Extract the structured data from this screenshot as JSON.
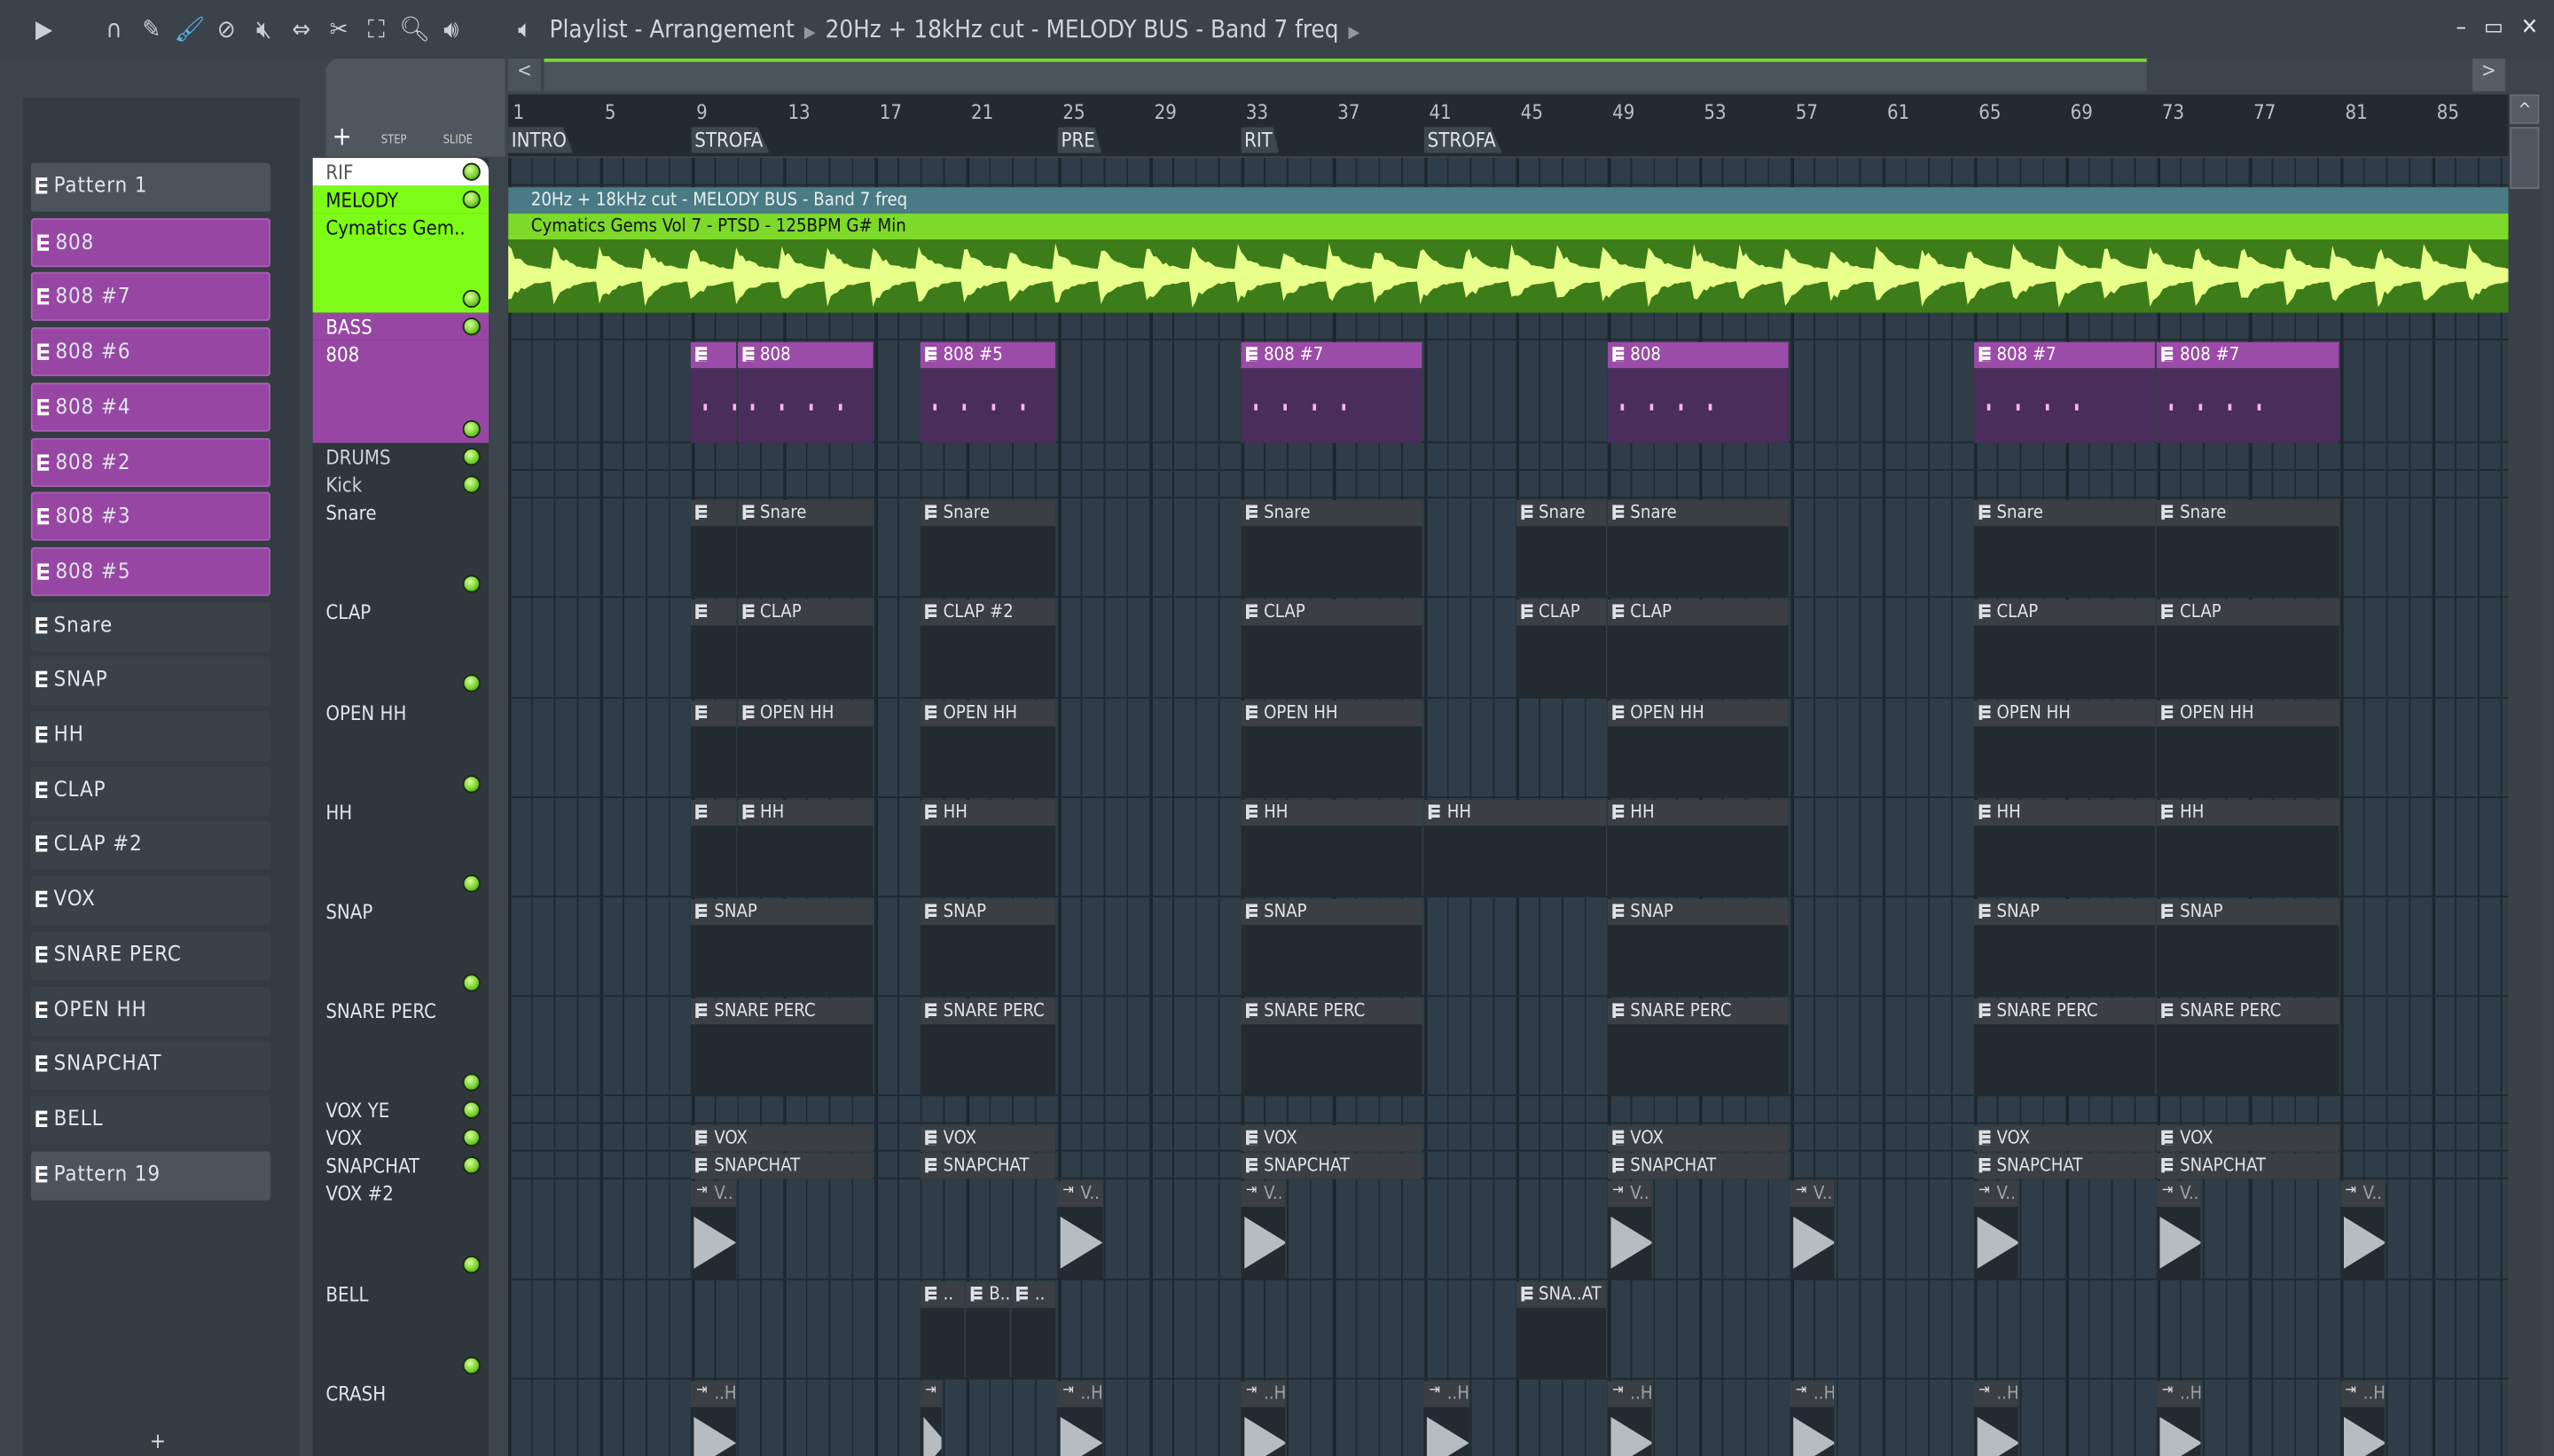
{
  "titlebar": {
    "breadcrumb": [
      "Playlist - Arrangement",
      "20Hz + 18kHz cut - MELODY BUS - Band 7 freq"
    ],
    "tools": [
      "play-arrow-icon",
      "magnet-icon",
      "pencil-icon",
      "paint-icon",
      "delete-icon",
      "mute-icon",
      "slip-icon",
      "slice-icon",
      "select-icon",
      "zoom-icon",
      "playback-icon"
    ],
    "minimize": "–",
    "maximize": "▭",
    "close": "✕"
  },
  "toolbar": {
    "add": "+",
    "step": "STEP",
    "slide": "SLIDE",
    "scroll_left": "<",
    "scroll_right": ">"
  },
  "picker": [
    {
      "label": "Pattern 1",
      "style": "grey"
    },
    {
      "label": "808",
      "style": "purple"
    },
    {
      "label": "808 #7",
      "style": "purple"
    },
    {
      "label": "808 #6",
      "style": "purple"
    },
    {
      "label": "808 #4",
      "style": "purple"
    },
    {
      "label": "808 #2",
      "style": "purple"
    },
    {
      "label": "808 #3",
      "style": "purple"
    },
    {
      "label": "808 #5",
      "style": "purple"
    },
    {
      "label": "Snare",
      "style": ""
    },
    {
      "label": "SNAP",
      "style": ""
    },
    {
      "label": "HH",
      "style": ""
    },
    {
      "label": "CLAP",
      "style": ""
    },
    {
      "label": "CLAP #2",
      "style": ""
    },
    {
      "label": "VOX",
      "style": ""
    },
    {
      "label": "SNARE PERC",
      "style": ""
    },
    {
      "label": "OPEN HH",
      "style": ""
    },
    {
      "label": "SNAPCHAT",
      "style": ""
    },
    {
      "label": "BELL",
      "style": ""
    },
    {
      "label": "Pattern 19",
      "style": "grey"
    }
  ],
  "ruler": {
    "ticks": [
      "1",
      "5",
      "9",
      "13",
      "17",
      "21",
      "25",
      "29",
      "33",
      "37",
      "41",
      "45",
      "49",
      "53",
      "57",
      "61",
      "65",
      "69",
      "73",
      "77",
      "81",
      "85"
    ],
    "markers": [
      {
        "label": "INTRO",
        "bar": 1
      },
      {
        "label": "STROFA",
        "bar": 9
      },
      {
        "label": "PRE",
        "bar": 25
      },
      {
        "label": "RIT",
        "bar": 33
      },
      {
        "label": "STROFA",
        "bar": 41
      }
    ]
  },
  "tracks": [
    {
      "name": "RIF",
      "rows": 1,
      "bg": "#ffffff",
      "fg": "#555",
      "led": true
    },
    {
      "name": "MELODY",
      "rows": 1,
      "bg": "#7dfc17",
      "fg": "#111",
      "led": true
    },
    {
      "name": "Cymatics Gem..",
      "rows": 3.6,
      "bg": "#7dfc17",
      "fg": "#111",
      "led": true
    },
    {
      "name": "BASS",
      "rows": 1,
      "bg": "#9747a3",
      "fg": "#fff",
      "led": true
    },
    {
      "name": "808",
      "rows": 3.7,
      "bg": "#9747a3",
      "fg": "#fff",
      "led": true
    },
    {
      "name": "DRUMS",
      "rows": 1,
      "bg": "#2f363c",
      "fg": "#cfd6db",
      "led": true
    },
    {
      "name": "Kick",
      "rows": 1,
      "bg": "#2f363c",
      "fg": "#cfd6db",
      "led": true
    },
    {
      "name": "Snare",
      "rows": 3.6,
      "bg": "#2f363c",
      "fg": "#dfe5ea",
      "led": true
    },
    {
      "name": "CLAP",
      "rows": 3.6,
      "bg": "#2f363c",
      "fg": "#dfe5ea",
      "led": true
    },
    {
      "name": "OPEN HH",
      "rows": 3.6,
      "bg": "#2f363c",
      "fg": "#dfe5ea",
      "led": true
    },
    {
      "name": "HH",
      "rows": 3.6,
      "bg": "#2f363c",
      "fg": "#dfe5ea",
      "led": true
    },
    {
      "name": "SNAP",
      "rows": 3.6,
      "bg": "#2f363c",
      "fg": "#dfe5ea",
      "led": true
    },
    {
      "name": "SNARE PERC",
      "rows": 3.6,
      "bg": "#2f363c",
      "fg": "#dfe5ea",
      "led": true
    },
    {
      "name": "VOX YE",
      "rows": 1,
      "bg": "#2f363c",
      "fg": "#dfe5ea",
      "led": true
    },
    {
      "name": "VOX",
      "rows": 1,
      "bg": "#2f363c",
      "fg": "#dfe5ea",
      "led": true
    },
    {
      "name": "SNAPCHAT",
      "rows": 1,
      "bg": "#2f363c",
      "fg": "#dfe5ea",
      "led": true
    },
    {
      "name": "VOX #2",
      "rows": 3.6,
      "bg": "#2f363c",
      "fg": "#dfe5ea",
      "led": true
    },
    {
      "name": "BELL",
      "rows": 3.6,
      "bg": "#2f363c",
      "fg": "#dfe5ea",
      "led": true
    },
    {
      "name": "CRASH",
      "rows": 3.6,
      "bg": "#2f363c",
      "fg": "#dfe5ea",
      "led": true
    }
  ],
  "melody": {
    "automation": "20Hz + 18kHz cut - MELODY BUS - Band 7 freq",
    "audio": "Cymatics Gems Vol 7 - PTSD - 125BPM G# Min"
  },
  "clips": [
    {
      "track": 4,
      "type": "bass",
      "items": [
        [
          9,
          2,
          ""
        ],
        [
          11,
          6,
          "808"
        ],
        [
          19,
          6,
          "808 #5"
        ],
        [
          33,
          8,
          "808 #7"
        ],
        [
          49,
          8,
          "808"
        ],
        [
          65,
          8,
          "808 #7"
        ],
        [
          73,
          8,
          "808 #7"
        ]
      ]
    },
    {
      "track": 7,
      "type": "pat",
      "items": [
        [
          9,
          2,
          ""
        ],
        [
          11,
          6,
          "Snare"
        ],
        [
          19,
          6,
          "Snare"
        ],
        [
          33,
          8,
          "Snare"
        ],
        [
          45,
          4,
          "Snare"
        ],
        [
          49,
          8,
          "Snare"
        ],
        [
          65,
          8,
          "Snare"
        ],
        [
          73,
          8,
          "Snare"
        ]
      ]
    },
    {
      "track": 8,
      "type": "pat",
      "items": [
        [
          9,
          2,
          ""
        ],
        [
          11,
          6,
          "CLAP"
        ],
        [
          19,
          6,
          "CLAP #2"
        ],
        [
          33,
          8,
          "CLAP"
        ],
        [
          45,
          4,
          "CLAP"
        ],
        [
          49,
          8,
          "CLAP"
        ],
        [
          65,
          8,
          "CLAP"
        ],
        [
          73,
          8,
          "CLAP"
        ]
      ]
    },
    {
      "track": 9,
      "type": "pat",
      "items": [
        [
          9,
          2,
          ""
        ],
        [
          11,
          6,
          "OPEN HH"
        ],
        [
          19,
          6,
          "OPEN HH"
        ],
        [
          33,
          8,
          "OPEN HH"
        ],
        [
          49,
          8,
          "OPEN HH"
        ],
        [
          65,
          8,
          "OPEN HH"
        ],
        [
          73,
          8,
          "OPEN HH"
        ]
      ]
    },
    {
      "track": 10,
      "type": "pat",
      "items": [
        [
          9,
          2,
          ""
        ],
        [
          11,
          6,
          "HH"
        ],
        [
          19,
          6,
          "HH"
        ],
        [
          33,
          8,
          "HH"
        ],
        [
          41,
          8,
          "HH"
        ],
        [
          49,
          8,
          "HH"
        ],
        [
          65,
          8,
          "HH"
        ],
        [
          73,
          8,
          "HH"
        ]
      ]
    },
    {
      "track": 11,
      "type": "pat",
      "items": [
        [
          9,
          8,
          "SNAP"
        ],
        [
          19,
          6,
          "SNAP"
        ],
        [
          33,
          8,
          "SNAP"
        ],
        [
          49,
          8,
          "SNAP"
        ],
        [
          65,
          8,
          "SNAP"
        ],
        [
          73,
          8,
          "SNAP"
        ]
      ]
    },
    {
      "track": 12,
      "type": "pat",
      "items": [
        [
          9,
          8,
          "SNARE PERC"
        ],
        [
          19,
          6,
          "SNARE PERC"
        ],
        [
          33,
          8,
          "SNARE PERC"
        ],
        [
          49,
          8,
          "SNARE PERC"
        ],
        [
          65,
          8,
          "SNARE PERC"
        ],
        [
          73,
          8,
          "SNARE PERC"
        ]
      ]
    },
    {
      "track": 14,
      "type": "pat",
      "items": [
        [
          9,
          8,
          "VOX"
        ],
        [
          19,
          6,
          "VOX"
        ],
        [
          33,
          8,
          "VOX"
        ],
        [
          49,
          8,
          "VOX"
        ],
        [
          65,
          8,
          "VOX"
        ],
        [
          73,
          8,
          "VOX"
        ]
      ]
    },
    {
      "track": 15,
      "type": "pat",
      "items": [
        [
          9,
          8,
          "SNAPCHAT"
        ],
        [
          19,
          6,
          "SNAPCHAT"
        ],
        [
          33,
          8,
          "SNAPCHAT"
        ],
        [
          49,
          8,
          "SNAPCHAT"
        ],
        [
          65,
          8,
          "SNAPCHAT"
        ],
        [
          73,
          8,
          "SNAPCHAT"
        ]
      ]
    },
    {
      "track": 16,
      "type": "aud",
      "items": [
        [
          9,
          2,
          "V.."
        ],
        [
          25,
          2,
          "V.."
        ],
        [
          33,
          2,
          "V.."
        ],
        [
          49,
          2,
          "V.."
        ],
        [
          57,
          2,
          "V.."
        ],
        [
          65,
          2,
          "V.."
        ],
        [
          73,
          2,
          "V.."
        ],
        [
          81,
          2,
          "V.."
        ]
      ]
    },
    {
      "track": 17,
      "type": "pat",
      "items": [
        [
          19,
          2,
          ".."
        ],
        [
          21,
          2,
          "B.."
        ],
        [
          23,
          2,
          ".."
        ],
        [
          45,
          4,
          "SNA..AT"
        ]
      ]
    },
    {
      "track": 18,
      "type": "aud",
      "items": [
        [
          9,
          2,
          "..H"
        ],
        [
          19,
          1,
          ""
        ],
        [
          25,
          2,
          "..H"
        ],
        [
          33,
          2,
          "..H"
        ],
        [
          41,
          2,
          "..H"
        ],
        [
          49,
          2,
          "..H"
        ],
        [
          57,
          2,
          "..H"
        ],
        [
          65,
          2,
          "..H"
        ],
        [
          73,
          2,
          "..H"
        ],
        [
          81,
          2,
          "..H"
        ]
      ]
    }
  ],
  "colors": {
    "melody": "#7dfc17",
    "bass": "#9747a3",
    "wave": "#e8ff8a"
  }
}
